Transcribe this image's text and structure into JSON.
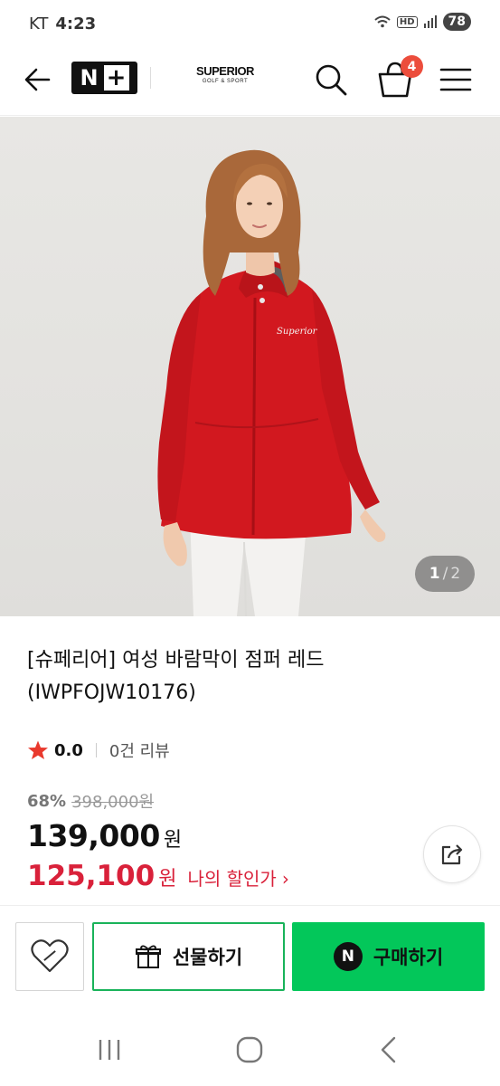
{
  "status_bar": {
    "carrier": "KT",
    "time": "4:23",
    "battery": "78"
  },
  "header": {
    "brand_badge": "N",
    "brand_logo_line1": "SUPERIOR",
    "brand_logo_line2": "GOLF & SPORT",
    "cart_count": "4"
  },
  "gallery": {
    "current": "1",
    "separator": "/",
    "total": "2"
  },
  "product": {
    "title": "[슈페리어] 여성 바람막이 점퍼 레드 (IWPFOJW10176)",
    "rating": "0.0",
    "review_count": "0건 리뷰",
    "discount_rate": "68%",
    "original_price": "398,000원",
    "price": "139,000",
    "price_unit": "원",
    "my_price": "125,100",
    "my_price_unit": "원",
    "my_price_label": "나의 할인가",
    "my_price_chevron": "›"
  },
  "actions": {
    "gift_label": "선물하기",
    "buy_label": "구매하기",
    "npay_mark": "N"
  },
  "colors": {
    "accent_green": "#03c75a",
    "discount_red": "#d9213a",
    "badge_red": "#ec4d3c",
    "jacket_red": "#d2181f"
  }
}
